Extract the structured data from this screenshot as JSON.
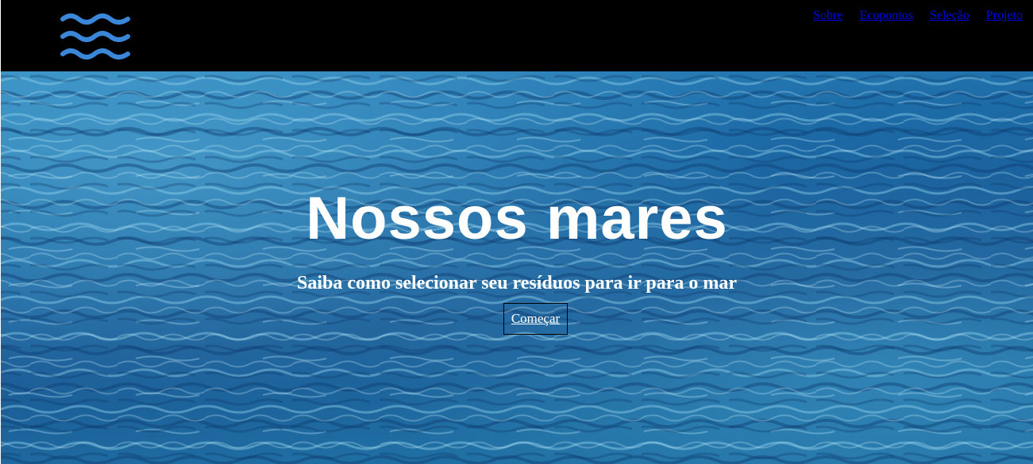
{
  "header": {
    "logo_icon": "waves-icon",
    "logo_color": "#3a86d8",
    "background": "#000000",
    "nav": [
      {
        "label": "Sobre"
      },
      {
        "label": "Ecopontos"
      },
      {
        "label": "Seleção"
      },
      {
        "label": "Projeto"
      }
    ],
    "link_color": "#0000ee"
  },
  "hero": {
    "background_image": "ocean-water-surface",
    "title": "Nossos mares",
    "subtitle": "Saiba como selecionar seu resíduos para ir para o mar",
    "button_label": "Começar",
    "text_color": "#ffffff"
  }
}
